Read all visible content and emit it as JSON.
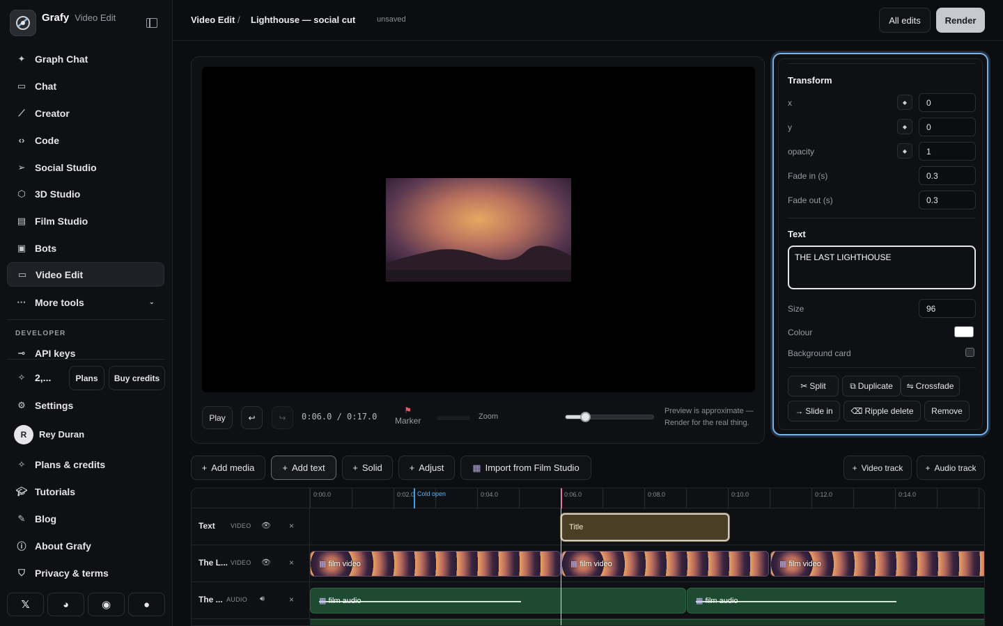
{
  "app": {
    "name": "Grafy",
    "section": "Video Edit"
  },
  "sidebar": {
    "items": [
      {
        "label": "Graph Chat",
        "icon": "sparkle-icon"
      },
      {
        "label": "Chat",
        "icon": "chat-icon"
      },
      {
        "label": "Creator",
        "icon": "wand-icon"
      },
      {
        "label": "Code",
        "icon": "code-icon"
      },
      {
        "label": "Social Studio",
        "icon": "send-icon"
      },
      {
        "label": "3D Studio",
        "icon": "cube-icon"
      },
      {
        "label": "Film Studio",
        "icon": "film-icon"
      },
      {
        "label": "Bots",
        "icon": "bot-icon"
      },
      {
        "label": "Video Edit",
        "icon": "video-icon"
      },
      {
        "label": "More tools",
        "icon": "more-icon"
      }
    ],
    "developer_label": "DEVELOPER",
    "api_keys": "API keys",
    "credits_value": "2,...",
    "plans_label": "Plans",
    "buy_credits_label": "Buy credits",
    "settings": "Settings",
    "user": {
      "initial": "R",
      "name": "Rey Duran"
    },
    "plans_credits": "Plans & credits",
    "tutorials": "Tutorials",
    "blog": "Blog",
    "about": "About Grafy",
    "privacy": "Privacy & terms"
  },
  "topbar": {
    "crumb_root": "Video Edit",
    "crumb_sep": "/",
    "project": "Lighthouse — social cut",
    "status": "unsaved",
    "all_edits": "All edits",
    "render": "Render"
  },
  "preview": {
    "play": "Play",
    "timecode": "0:06.0 / 0:17.0",
    "marker": "Marker",
    "zoom": "Zoom",
    "zoom_level": 0.22,
    "note_line1": "Preview is approximate —",
    "note_line2": "Render for the real thing."
  },
  "inspector": {
    "transform_title": "Transform",
    "fields": [
      {
        "label": "x",
        "value": "0"
      },
      {
        "label": "y",
        "value": "0"
      },
      {
        "label": "opacity",
        "value": "1"
      },
      {
        "label": "Fade in (s)",
        "value": "0.3"
      },
      {
        "label": "Fade out (s)",
        "value": "0.3"
      }
    ],
    "text_title": "Text",
    "text_value": "THE LAST LIGHTHOUSE",
    "size_label": "Size",
    "size_value": "96",
    "colour_label": "Colour",
    "colour_value": "#ffffff",
    "bg_card_label": "Background card",
    "actions": [
      "Split",
      "Duplicate",
      "Crossfade",
      "Slide in",
      "Ripple delete",
      "Remove"
    ]
  },
  "toolbar": {
    "add_media": "Add media",
    "add_text": "Add text",
    "solid": "Solid",
    "adjust": "Adjust",
    "import_film": "Import from Film Studio",
    "video_track": "Video track",
    "audio_track": "Audio track"
  },
  "timeline": {
    "ticks": [
      "0:00.0",
      "0:02.0",
      "0:04.0",
      "0:06.0",
      "0:08.0",
      "0:10.0",
      "0:12.0",
      "0:14.0"
    ],
    "marker_label": "Cold open",
    "tracks": [
      {
        "name": "Text",
        "kind": "VIDEO"
      },
      {
        "name": "The L...",
        "kind": "VIDEO"
      },
      {
        "name": "The ...",
        "kind": "AUDIO"
      }
    ],
    "title_clip": "Title",
    "video_clip": "film video",
    "audio_clip": "film audio"
  }
}
